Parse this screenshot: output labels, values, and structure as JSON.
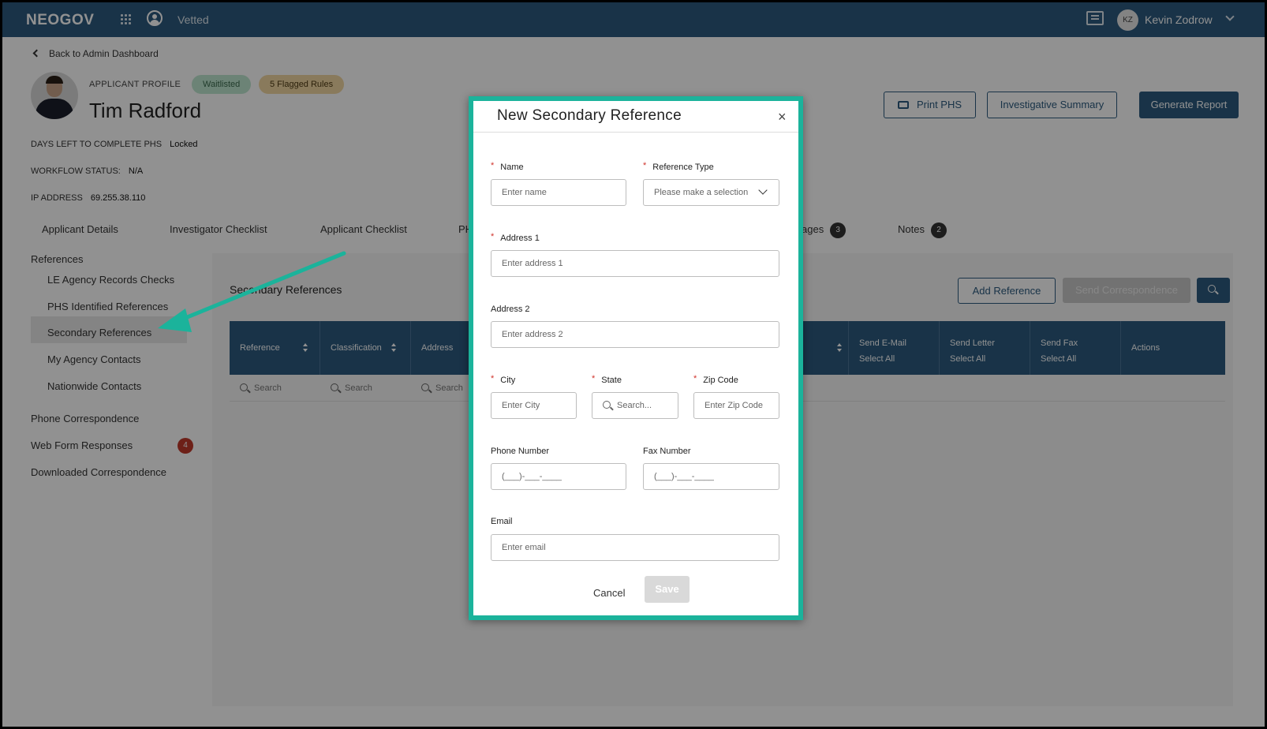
{
  "header": {
    "brand": "NEOGOV",
    "app_name": "Vetted",
    "user_initials": "KZ",
    "user_name": "Kevin Zodrow"
  },
  "back_link": "Back to Admin Dashboard",
  "profile": {
    "label": "APPLICANT PROFILE",
    "badge_status": "Waitlisted",
    "badge_flags": "5 Flagged Rules",
    "name": "Tim Radford",
    "days_left_label": "DAYS LEFT TO COMPLETE PHS",
    "days_left_value": "Locked",
    "workflow_label": "WORKFLOW STATUS:",
    "workflow_value": "N/A",
    "ip_label": "IP ADDRESS",
    "ip_value": "69.255.38.110"
  },
  "actions": {
    "print": "Print PHS",
    "summary": "Investigative Summary",
    "report": "Generate Report"
  },
  "tabs": [
    {
      "label": "Applicant Details"
    },
    {
      "label": "Investigator Checklist"
    },
    {
      "label": "Applicant Checklist"
    },
    {
      "label": "PH"
    },
    {
      "label": "ages",
      "count": "3"
    },
    {
      "label": "Notes",
      "count": "2"
    }
  ],
  "sidebar": {
    "section": "References",
    "items": [
      "LE Agency Records Checks",
      "PHS Identified References",
      "Secondary References",
      "My Agency Contacts",
      "Nationwide Contacts"
    ],
    "phone": "Phone Correspondence",
    "webform": "Web Form Responses",
    "webform_count": "4",
    "downloaded": "Downloaded Correspondence"
  },
  "panel": {
    "title": "Secondary References",
    "add_button": "Add Reference",
    "send_button": "Send Correspondence",
    "columns": {
      "reference": "Reference",
      "classification": "Classification",
      "address": "Address",
      "email": "Send E-Mail",
      "letter": "Send Letter",
      "fax": "Send Fax",
      "select_all": "Select All",
      "actions": "Actions"
    },
    "search_placeholder": "Search"
  },
  "modal": {
    "title": "New Secondary Reference",
    "close": "×",
    "name_label": "Name",
    "name_placeholder": "Enter name",
    "type_label": "Reference Type",
    "type_value": "Please make a selection",
    "address1_label": "Address 1",
    "address1_placeholder": "Enter address 1",
    "address2_label": "Address 2",
    "address2_placeholder": "Enter address 2",
    "city_label": "City",
    "city_placeholder": "Enter City",
    "state_label": "State",
    "state_placeholder": "Search...",
    "zip_label": "Zip Code",
    "zip_placeholder": "Enter Zip Code",
    "phone_label": "Phone Number",
    "phone_placeholder": "(___)-___-____",
    "fax_label": "Fax Number",
    "fax_placeholder": "(___)-___-____",
    "email_label": "Email",
    "email_placeholder": "Enter email",
    "cancel": "Cancel",
    "save": "Save"
  },
  "colors": {
    "brand": "#2c5b7f",
    "highlight": "#1bb39b",
    "required": "#d0342c"
  }
}
